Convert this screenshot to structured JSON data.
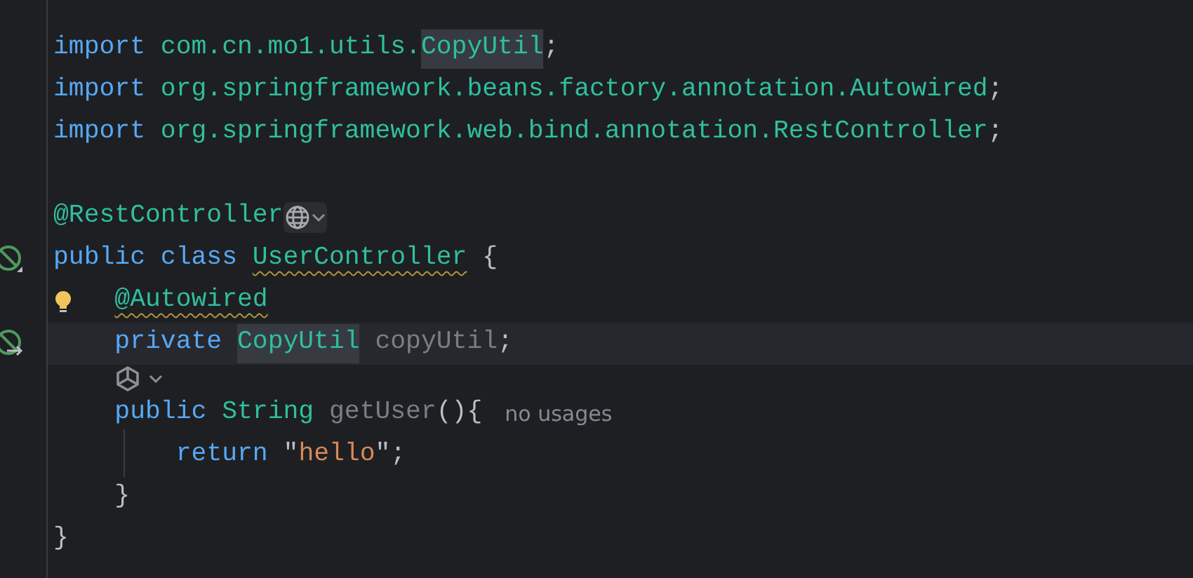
{
  "editor": {
    "lines": [
      {
        "kind": "code",
        "words": [
          [
            {
              "text": "import",
              "kind": "keyword"
            }
          ],
          [
            {
              "text": "com.cn.mo1.utils.",
              "kind": "package"
            },
            {
              "text": "CopyUtil",
              "kind": "package",
              "highlighted": true
            },
            {
              "text": ";",
              "kind": "punct"
            }
          ]
        ]
      },
      {
        "kind": "code",
        "words": [
          [
            {
              "text": "import",
              "kind": "keyword"
            }
          ],
          [
            {
              "text": "org.springframework.beans.factory.annotation.Autowired",
              "kind": "package"
            },
            {
              "text": ";",
              "kind": "punct"
            }
          ]
        ]
      },
      {
        "kind": "code",
        "words": [
          [
            {
              "text": "import",
              "kind": "keyword"
            }
          ],
          [
            {
              "text": "org.springframework.web.bind.annotation.RestController",
              "kind": "package"
            },
            {
              "text": ";",
              "kind": "punct"
            }
          ]
        ]
      },
      {
        "kind": "blank"
      },
      {
        "kind": "code",
        "words": [
          [
            {
              "text": "@RestController",
              "kind": "annotation"
            }
          ]
        ],
        "inlay": {
          "kind": "endpoint"
        }
      },
      {
        "kind": "code",
        "gutter": {
          "kind": "bean"
        },
        "words": [
          [
            {
              "text": "public",
              "kind": "keyword"
            }
          ],
          [
            {
              "text": "class",
              "kind": "keyword"
            }
          ],
          [
            {
              "text": "UserController",
              "kind": "type",
              "warning": true
            }
          ],
          [
            {
              "text": "{",
              "kind": "punct"
            }
          ]
        ],
        "children": [
          {
            "kind": "code",
            "gutter": {
              "kind": "bulb"
            },
            "words": [
              [
                {
                  "text": "@Autowired",
                  "kind": "annotation",
                  "warning": true
                }
              ]
            ]
          },
          {
            "kind": "code",
            "gutter": {
              "kind": "bean-arrow"
            },
            "current": true,
            "words": [
              [
                {
                  "text": "private",
                  "kind": "keyword"
                }
              ],
              [
                {
                  "text": "CopyUtil",
                  "kind": "type",
                  "highlighted": true
                }
              ],
              [
                {
                  "text": "copyUtil",
                  "kind": "unused"
                },
                {
                  "text": ";",
                  "kind": "punct"
                }
              ]
            ]
          },
          {
            "kind": "hint"
          },
          {
            "kind": "code",
            "words": [
              [
                {
                  "text": "public",
                  "kind": "keyword"
                }
              ],
              [
                {
                  "text": "String",
                  "kind": "type"
                }
              ],
              [
                {
                  "text": "getUser",
                  "kind": "unused"
                },
                {
                  "text": "(){",
                  "kind": "punct"
                }
              ]
            ],
            "usage_hint": "no usages",
            "children": [
              {
                "kind": "code",
                "guide": true,
                "words": [
                  [
                    {
                      "text": "return",
                      "kind": "keyword"
                    }
                  ],
                  [
                    {
                      "text": "\"",
                      "kind": "punct"
                    },
                    {
                      "text": "hello",
                      "kind": "string"
                    },
                    {
                      "text": "\";",
                      "kind": "punct"
                    }
                  ]
                ]
              }
            ]
          },
          {
            "kind": "code",
            "words": [
              [
                {
                  "text": "}",
                  "kind": "punct"
                }
              ]
            ]
          }
        ]
      },
      {
        "kind": "code",
        "words": [
          [
            {
              "text": "}",
              "kind": "punct"
            }
          ]
        ]
      }
    ]
  }
}
